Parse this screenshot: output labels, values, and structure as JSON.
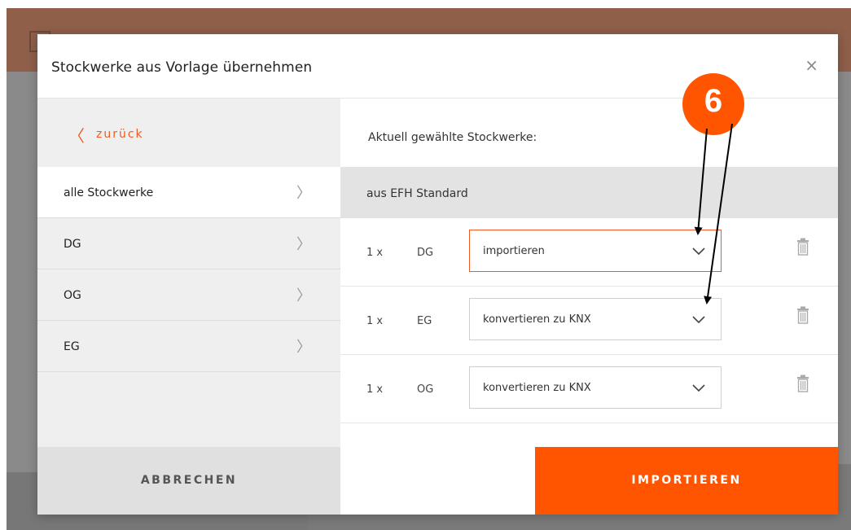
{
  "dialog": {
    "title": "Stockwerke aus Vorlage übernehmen",
    "close_symbol": "×"
  },
  "sidebar": {
    "back_label": "zurück",
    "back_icon": "chevron-left-icon",
    "items": [
      {
        "label": "alle Stockwerke",
        "active": true
      },
      {
        "label": "DG"
      },
      {
        "label": "OG"
      },
      {
        "label": "EG"
      }
    ]
  },
  "main": {
    "selected_title": "Aktuell gewählte Stockwerke:",
    "group_label": "aus EFH Standard",
    "rows": [
      {
        "qty": "1 x",
        "floor": "DG",
        "action": "importieren"
      },
      {
        "qty": "1 x",
        "floor": "EG",
        "action": "konvertieren zu KNX"
      },
      {
        "qty": "1 x",
        "floor": "OG",
        "action": "konvertieren zu KNX"
      }
    ]
  },
  "footer": {
    "cancel_label": "ABBRECHEN",
    "import_label": "IMPORTIEREN"
  },
  "annotation": {
    "badge_number": "6"
  },
  "colors": {
    "accent": "#ff5500",
    "link": "#f05a22"
  }
}
